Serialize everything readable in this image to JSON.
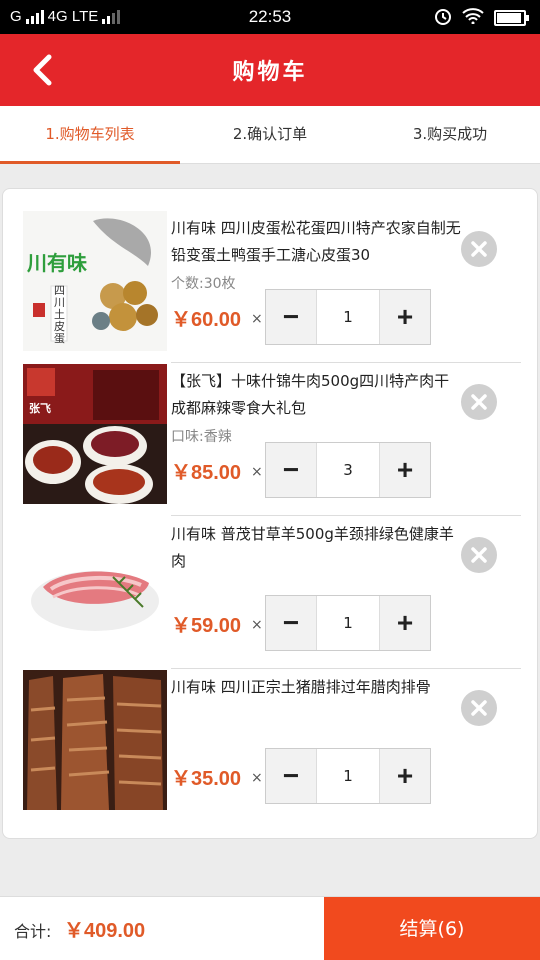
{
  "status_bar": {
    "carrier_g": "G",
    "network": "4G LTE",
    "time": "22:53"
  },
  "header": {
    "title": "购物车",
    "back_icon": "chevron-left-icon"
  },
  "steps": [
    {
      "label": "1.购物车列表",
      "active": true
    },
    {
      "label": "2.确认订单",
      "active": false
    },
    {
      "label": "3.购买成功",
      "active": false
    }
  ],
  "cart": {
    "items": [
      {
        "name": "川有味 四川皮蛋松花蛋四川特产农家自制无铅变蛋土鸭蛋手工溏心皮蛋30",
        "spec": "个数:30枚",
        "price": "￥60.00",
        "times": "×",
        "quantity": "1",
        "image_text_1": "川有味",
        "image_text_2": "四川土皮蛋"
      },
      {
        "name": "【张飞】十味什锦牛肉500g四川特产肉干成都麻辣零食大礼包",
        "spec": "口味:香辣",
        "price": "￥85.00",
        "times": "×",
        "quantity": "3",
        "image_text_1": "张飞"
      },
      {
        "name": "川有味 普茂甘草羊500g羊颈排绿色健康羊肉",
        "spec": "",
        "price": "￥59.00",
        "times": "×",
        "quantity": "1"
      },
      {
        "name": "川有味 四川正宗土猪腊排过年腊肉排骨",
        "spec": "",
        "price": "￥35.00",
        "times": "×",
        "quantity": "1"
      }
    ],
    "minus_label": "−",
    "plus_label": "+"
  },
  "footer": {
    "total_label": "合计:",
    "total_value": "￥409.00",
    "checkout_label": "结算(6)"
  },
  "colors": {
    "header_red": "#e4262a",
    "accent_orange": "#e05a28",
    "checkout_orange": "#f14a1e"
  }
}
